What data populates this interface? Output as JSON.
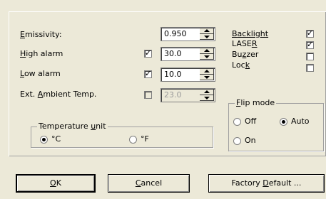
{
  "fields": {
    "emissivity": {
      "label_pre": "",
      "label_u": "E",
      "label_post": "missivity:",
      "value": "0.950"
    },
    "high_alarm": {
      "label_pre": "",
      "label_u": "H",
      "label_post": "igh alarm",
      "checked": true,
      "value": "30.0"
    },
    "low_alarm": {
      "label_pre": "",
      "label_u": "L",
      "label_post": "ow alarm",
      "checked": true,
      "value": "10.0"
    },
    "ambient": {
      "label_pre": "Ext. ",
      "label_u": "A",
      "label_post": "mbient Temp.",
      "checked": false,
      "value": "23.0"
    }
  },
  "options": {
    "backlight": {
      "label_u": "B",
      "label_post": "acklight",
      "checked": true
    },
    "laser": {
      "label_pre": "LASE",
      "label_u": "R",
      "checked": true
    },
    "buzzer": {
      "label_pre": "Bu",
      "label_u": "z",
      "label_post": "zer",
      "checked": false
    },
    "lock": {
      "label_pre": "Loc",
      "label_u": "k",
      "checked": false
    }
  },
  "flip_mode": {
    "legend_u": "F",
    "legend_post": "lip mode",
    "off": "Off",
    "auto": "Auto",
    "on": "On",
    "selected": "auto"
  },
  "temp_unit": {
    "legend_pre": "Temperature ",
    "legend_u": "u",
    "legend_post": "nit",
    "celsius": "°C",
    "fahrenheit": "°F",
    "selected": "celsius"
  },
  "buttons": {
    "ok": {
      "u": "O",
      "post": "K"
    },
    "cancel": {
      "u": "C",
      "post": "ancel"
    },
    "factory": {
      "pre": "Factory ",
      "u": "D",
      "post": "efault ..."
    }
  }
}
